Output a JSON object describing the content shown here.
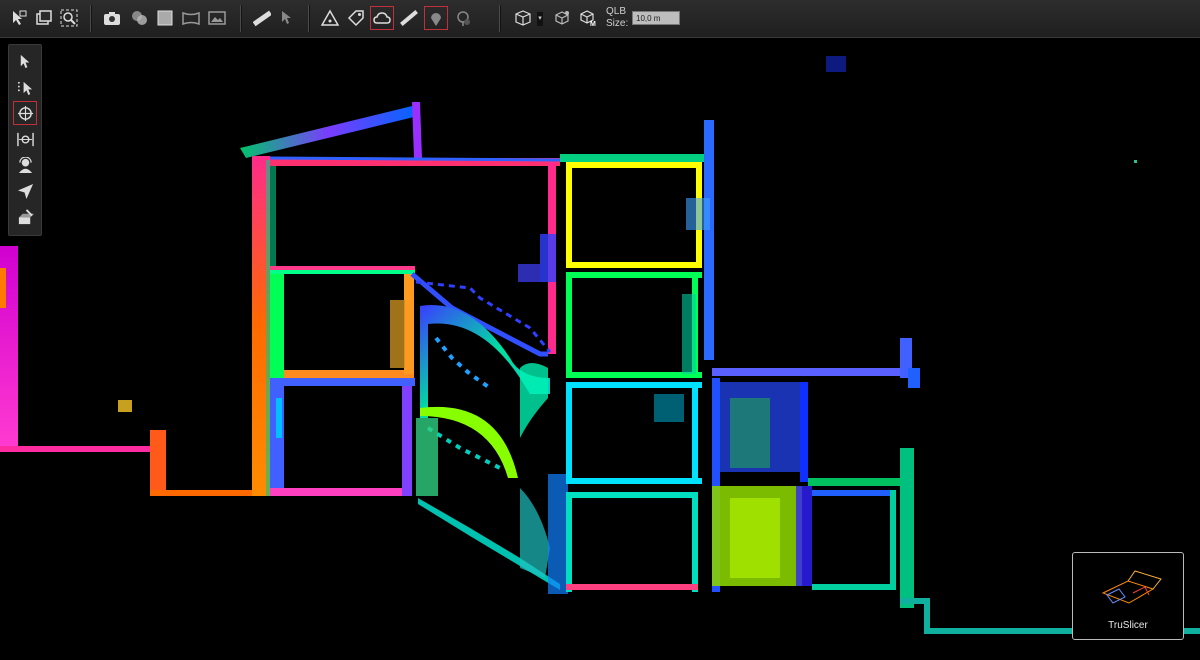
{
  "toolbar": {
    "tools": [
      {
        "name": "select-tool-icon"
      },
      {
        "name": "window-tool-icon"
      },
      {
        "name": "zoom-extent-icon"
      },
      {
        "name": "camera-icon"
      },
      {
        "name": "color-wheel-icon"
      },
      {
        "name": "square-view-icon"
      },
      {
        "name": "panorama-icon"
      },
      {
        "name": "image-icon"
      },
      {
        "name": "measure-ruler-icon"
      },
      {
        "name": "pick-point-icon"
      },
      {
        "name": "warning-triangle-icon"
      },
      {
        "name": "tag-icon"
      },
      {
        "name": "cloud-icon"
      },
      {
        "name": "pencil-measure-icon"
      },
      {
        "name": "location-pin-icon"
      },
      {
        "name": "target-settings-icon"
      },
      {
        "name": "cube-view-icon"
      },
      {
        "name": "cube-rotate-icon"
      },
      {
        "name": "cube-m-icon"
      }
    ],
    "qlb_label": "QLB",
    "size_label": "Size:",
    "size_value": "10,0 m"
  },
  "side_toolbar": {
    "tools": [
      {
        "name": "pointer-icon"
      },
      {
        "name": "dotted-pointer-icon"
      },
      {
        "name": "orbit-icon"
      },
      {
        "name": "pan-icon"
      },
      {
        "name": "walk-icon"
      },
      {
        "name": "fly-icon"
      },
      {
        "name": "slice-icon"
      }
    ]
  },
  "viewport": {
    "description_colors": [
      "#ff00cc",
      "#ff6600",
      "#00ff00",
      "#00ffff",
      "#0044ff",
      "#ffff00"
    ]
  },
  "truslicer": {
    "label": "TruSlicer"
  }
}
